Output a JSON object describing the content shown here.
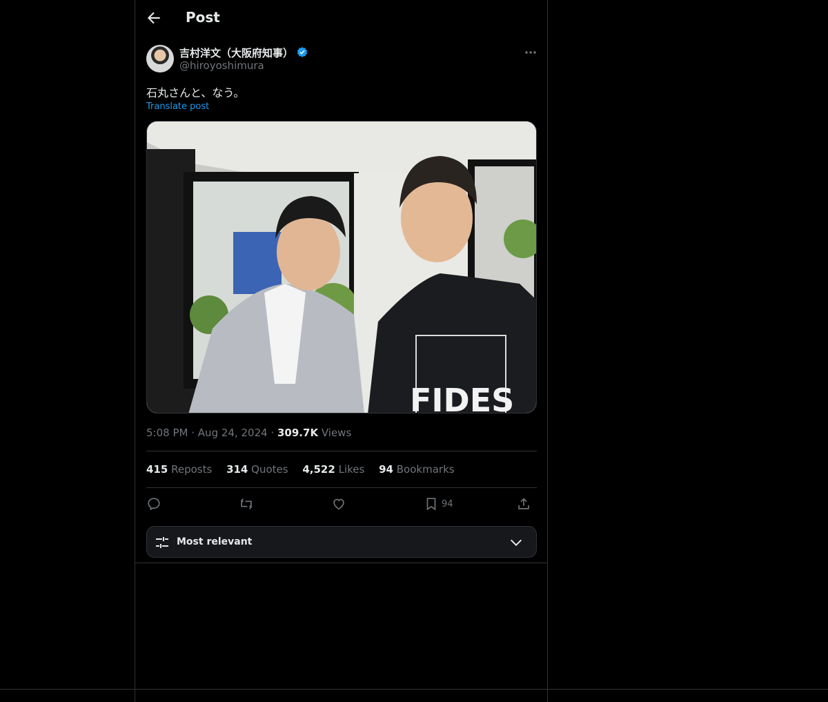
{
  "header": {
    "title": "Post"
  },
  "author": {
    "name": "吉村洋文（大阪府知事）",
    "handle": "@hiroyoshimura"
  },
  "post": {
    "text": "石丸さんと、なう。",
    "translate_label": "Translate post",
    "photo_text": "FIDES"
  },
  "meta": {
    "time": "5:08 PM",
    "dot1": "·",
    "date": "Aug 24, 2024",
    "dot2": "·",
    "views_count": "309.7K",
    "views_label": "Views"
  },
  "stats": [
    {
      "count": "415",
      "label": "Reposts"
    },
    {
      "count": "314",
      "label": "Quotes"
    },
    {
      "count": "4,522",
      "label": "Likes"
    },
    {
      "count": "94",
      "label": "Bookmarks"
    }
  ],
  "actions": {
    "bookmark_count": "94"
  },
  "filter": {
    "label": "Most relevant"
  },
  "colors": {
    "accent": "#1d9bf0",
    "muted": "#71767b",
    "text": "#e7e9ea",
    "border": "#2f3336"
  },
  "icons": [
    "back-arrow-icon",
    "verified-badge-icon",
    "more-icon",
    "reply-icon",
    "repost-icon",
    "like-icon",
    "bookmark-icon",
    "share-icon",
    "sliders-icon",
    "chevron-down-icon"
  ]
}
